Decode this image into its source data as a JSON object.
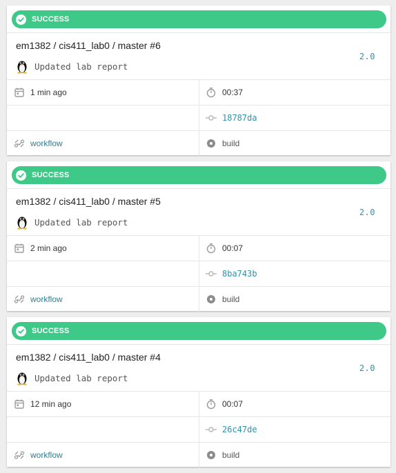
{
  "builds": [
    {
      "status": "SUCCESS",
      "title": "em1382 / cis411_lab0 / master #6",
      "version": "2.0",
      "message": "Updated lab report",
      "time_ago": "1 min ago",
      "duration": "00:37",
      "commit": "18787da",
      "workflow": "workflow",
      "job": "build"
    },
    {
      "status": "SUCCESS",
      "title": "em1382 / cis411_lab0 / master #5",
      "version": "2.0",
      "message": "Updated lab report",
      "time_ago": "2 min ago",
      "duration": "00:07",
      "commit": "8ba743b",
      "workflow": "workflow",
      "job": "build"
    },
    {
      "status": "SUCCESS",
      "title": "em1382 / cis411_lab0 / master #4",
      "version": "2.0",
      "message": "Updated lab report",
      "time_ago": "12 min ago",
      "duration": "00:07",
      "commit": "26c47de",
      "workflow": "workflow",
      "job": "build"
    }
  ],
  "colors": {
    "success": "#3ec988",
    "link": "#2e7d92",
    "mono_link": "#2e8faf"
  },
  "icons": {
    "status": "check-circle-icon",
    "avatar": "linux-tux-icon",
    "time": "calendar-icon",
    "duration": "stopwatch-icon",
    "commit": "commit-icon",
    "workflow": "workflow-icon",
    "job": "job-dot-icon"
  }
}
